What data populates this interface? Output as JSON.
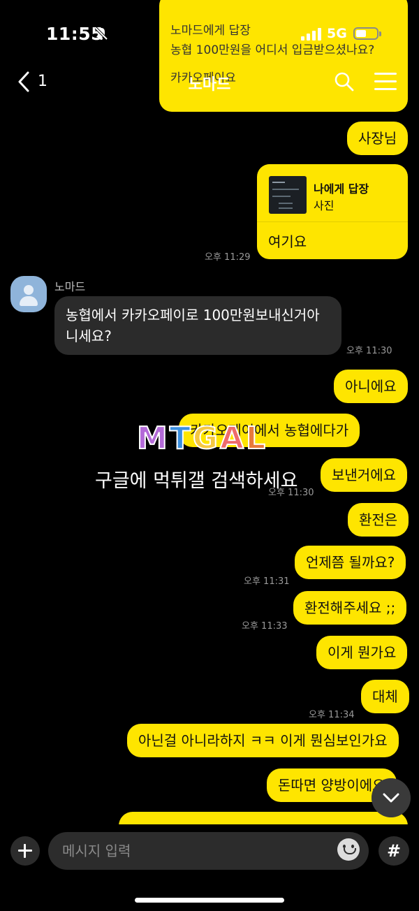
{
  "status": {
    "time": "11:55",
    "network": "5G"
  },
  "header": {
    "back_count": "1",
    "title": "노마드"
  },
  "top_reply": {
    "line1": "노마드에게 답장",
    "line2": "농협 100만원을 어디서 입금받으셨나요?",
    "line3": "카카오페이요"
  },
  "messages": {
    "m1": "사장님",
    "reply_card": {
      "title": "나에게 답장",
      "subtitle": "사진",
      "text": "여기요"
    },
    "t1": "오후 11:29",
    "sender": "노마드",
    "their1": "농협에서 카카오페이로 100만원보내신거아니세요?",
    "t2": "오후 11:30",
    "m2": "아니에요",
    "m3": "카카오페이에서 농협에다가",
    "m4": "보낸거에요",
    "t3": "오후 11:30",
    "m5": "환전은",
    "m6": "언제쯤 될까요?",
    "t4": "오후 11:31",
    "m7": "환전해주세요 ;;",
    "t5": "오후 11:33",
    "m8": "이게 뭔가요",
    "m9": "대체",
    "t6": "오후 11:34",
    "m10": "아닌걸 아니라하지 ㅋㅋ 이게 뭔심보인가요",
    "m11": "돈따면 양방이에요"
  },
  "watermark": {
    "logo": "MTGAL",
    "text": "구글에 먹튀갤 검색하세요"
  },
  "input": {
    "placeholder": "메시지 입력",
    "hash": "#"
  },
  "colors": {
    "my_bubble": "#fee500",
    "their_bubble": "#2b2b2b",
    "background": "#000000"
  }
}
